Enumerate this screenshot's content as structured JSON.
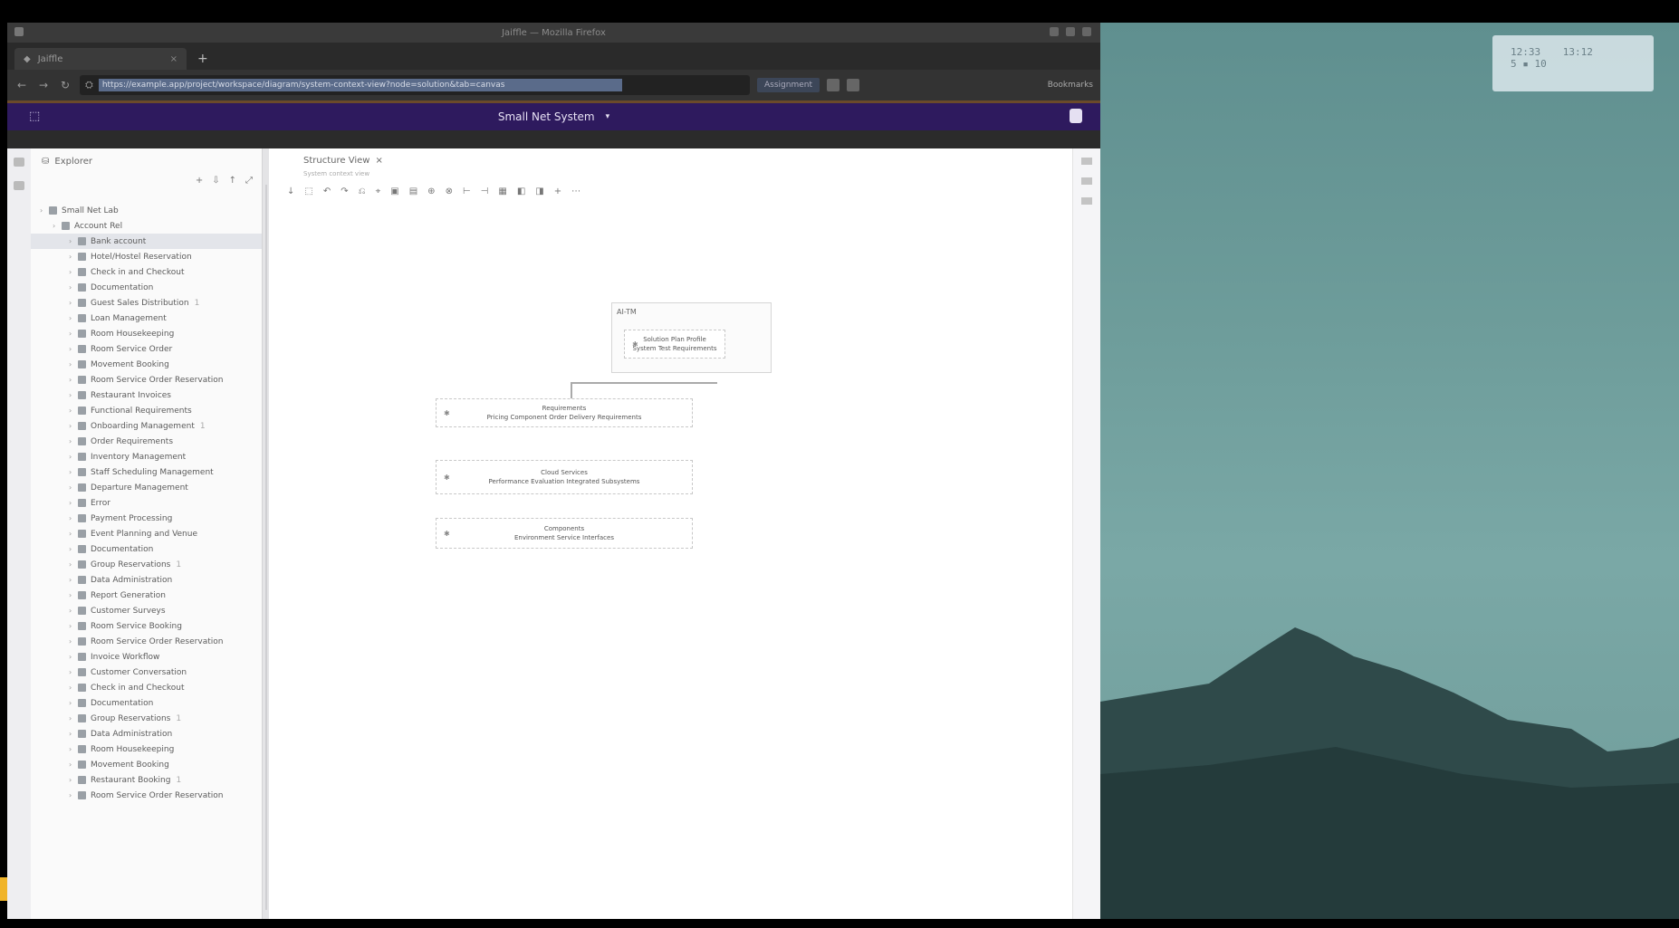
{
  "desktop": {
    "clock": {
      "left": "12:33",
      "right": "13:12",
      "sub": "5 ▪ 10"
    }
  },
  "browser": {
    "window_title": "Jaiffle — Mozilla Firefox",
    "tab": {
      "title": "Jaiffle",
      "close": "×",
      "new_tab": "+"
    },
    "url": "https://example.app/project/workspace/diagram/system-context-view?node=solution&tab=canvas",
    "extension_button": "Assignment",
    "bookmark_label": "Bookmarks"
  },
  "app": {
    "header_title": "Small Net System",
    "header_dropdown": "▾",
    "sidebar": {
      "title": "Explorer",
      "tools": [
        "+",
        "⇩",
        "↑",
        "⤢"
      ],
      "root": "Small Net Lab",
      "sub_root": "Account Rel",
      "items": [
        {
          "label": "Bank account",
          "selected": true
        },
        {
          "label": "Hotel/Hostel Reservation"
        },
        {
          "label": "Check in and Checkout"
        },
        {
          "label": "Documentation"
        },
        {
          "label": "Guest Sales Distribution",
          "tag": "1"
        },
        {
          "label": "Loan Management"
        },
        {
          "label": "Room Housekeeping"
        },
        {
          "label": "Room Service Order"
        },
        {
          "label": "Movement Booking"
        },
        {
          "label": "Room Service Order Reservation"
        },
        {
          "label": "Restaurant Invoices"
        },
        {
          "label": "Functional Requirements"
        },
        {
          "label": "Onboarding Management",
          "tag": "1"
        },
        {
          "label": "Order Requirements"
        },
        {
          "label": "Inventory Management"
        },
        {
          "label": "Staff Scheduling Management"
        },
        {
          "label": "Departure Management"
        },
        {
          "label": "Error"
        },
        {
          "label": "Payment Processing"
        },
        {
          "label": "Event Planning and Venue"
        },
        {
          "label": "Documentation"
        },
        {
          "label": "Group Reservations",
          "tag": "1"
        },
        {
          "label": "Data Administration"
        },
        {
          "label": "Report Generation"
        },
        {
          "label": "Customer Surveys"
        },
        {
          "label": "Room Service Booking"
        },
        {
          "label": "Room Service Order Reservation"
        },
        {
          "label": "Invoice Workflow"
        },
        {
          "label": "Customer Conversation"
        },
        {
          "label": "Check in and Checkout"
        },
        {
          "label": "Documentation"
        },
        {
          "label": "Group Reservations",
          "tag": "1"
        },
        {
          "label": "Data Administration"
        },
        {
          "label": "Room Housekeeping"
        },
        {
          "label": "Movement Booking"
        },
        {
          "label": "Restaurant Booking",
          "tag": "1"
        },
        {
          "label": "Room Service Order Reservation"
        }
      ]
    },
    "canvas": {
      "tab_label": "Structure View",
      "tab_close": "×",
      "subtitle": "System context view",
      "toolbar": [
        "↓",
        "⬚",
        "↶",
        "↷",
        "⎌",
        "⌖",
        "▣",
        "▤",
        "⊕",
        "⊗",
        "⊢",
        "⊣",
        "▦",
        "◧",
        "◨",
        "+",
        "⋯"
      ],
      "group_label": "AI-TM",
      "nodes": [
        {
          "title": "Solution Plan Profile",
          "sub": "System Test Requirements"
        },
        {
          "title": "Requirements",
          "sub": "Pricing Component Order Delivery Requirements"
        },
        {
          "title": "Cloud Services",
          "sub": "Performance Evaluation Integrated Subsystems"
        },
        {
          "title": "Components",
          "sub": "Environment Service Interfaces"
        }
      ]
    }
  }
}
